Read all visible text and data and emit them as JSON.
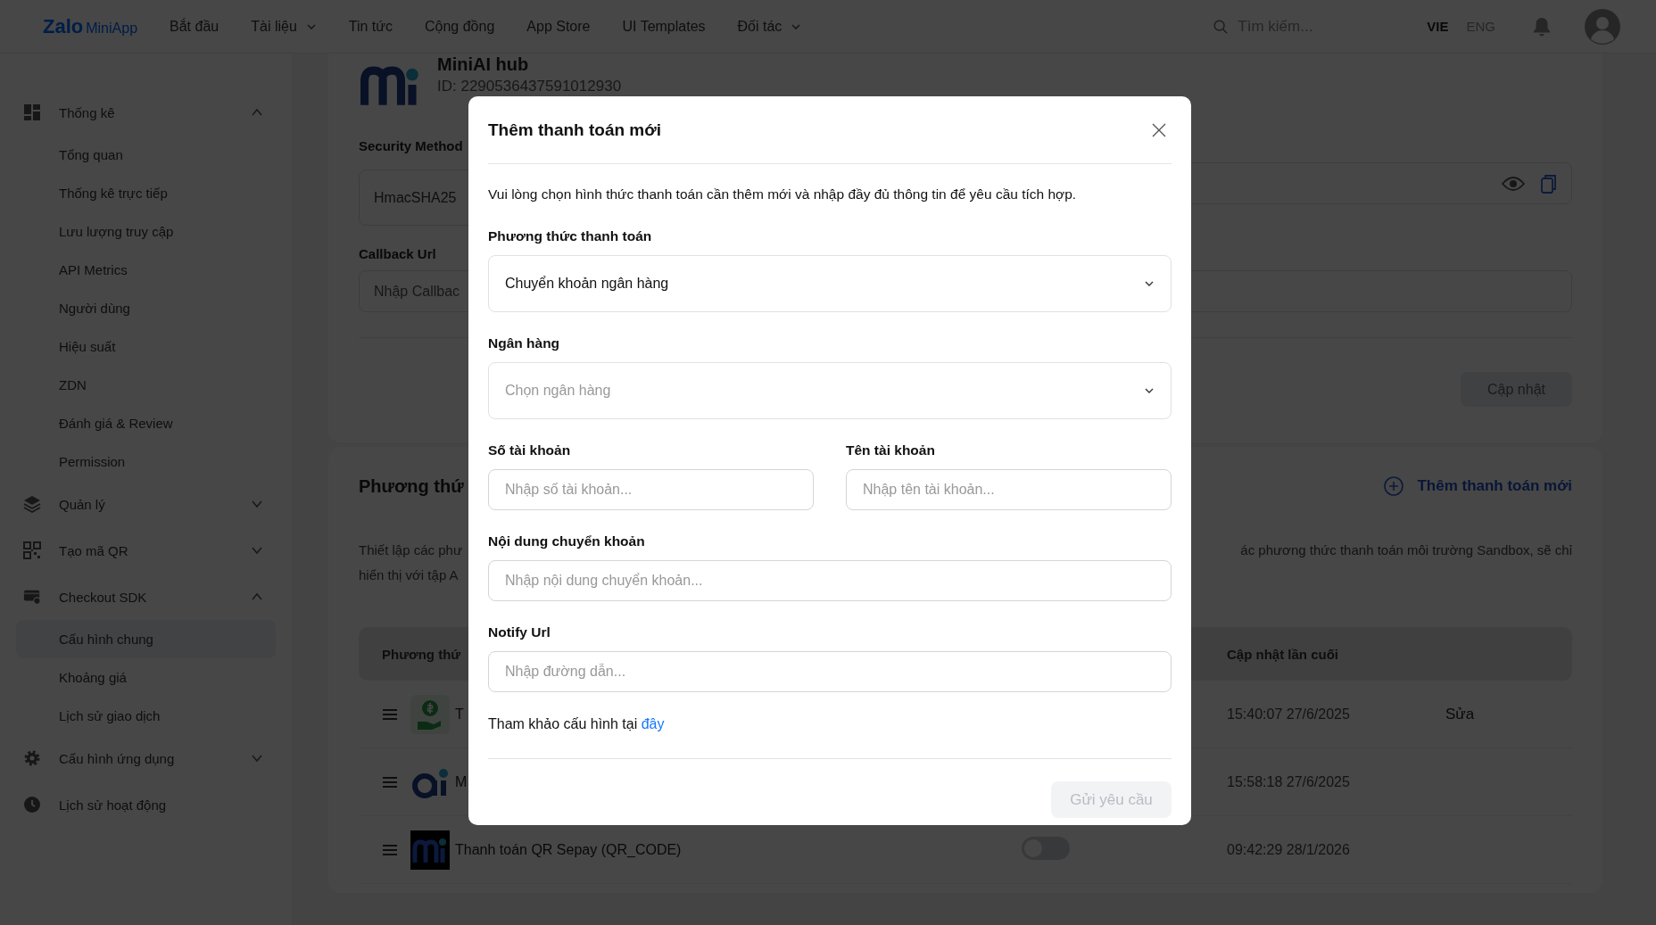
{
  "header": {
    "brand": "Zalo",
    "brand_sub": "MiniApp",
    "nav": [
      {
        "label": "Bắt đầu",
        "dropdown": false
      },
      {
        "label": "Tài liệu",
        "dropdown": true
      },
      {
        "label": "Tin tức",
        "dropdown": false
      },
      {
        "label": "Cộng đồng",
        "dropdown": false
      },
      {
        "label": "App Store",
        "dropdown": false
      },
      {
        "label": "UI Templates",
        "dropdown": false
      },
      {
        "label": "Đối tác",
        "dropdown": true
      }
    ],
    "search": {
      "placeholder": "Tìm kiếm..."
    },
    "languages": [
      {
        "label": "VIE",
        "selected": true
      },
      {
        "label": "ENG",
        "selected": false
      }
    ]
  },
  "sidebar": {
    "items": [
      {
        "label": "Thống kê",
        "expanded": true,
        "children": [
          {
            "label": "Tổng quan",
            "selected": false
          },
          {
            "label": "Thống kê trực tiếp",
            "selected": false
          },
          {
            "label": "Lưu lượng truy cập",
            "selected": false
          },
          {
            "label": "API Metrics",
            "selected": false
          },
          {
            "label": "Người dùng",
            "selected": false
          },
          {
            "label": "Hiệu suất",
            "selected": false
          },
          {
            "label": "ZDN",
            "selected": false
          },
          {
            "label": "Đánh giá & Review",
            "selected": false
          },
          {
            "label": "Permission",
            "selected": false
          }
        ]
      },
      {
        "label": "Quản lý",
        "expanded": false
      },
      {
        "label": "Tạo mã QR",
        "expanded": false
      },
      {
        "label": "Checkout SDK",
        "expanded": true,
        "children": [
          {
            "label": "Cấu hình chung",
            "selected": true
          },
          {
            "label": "Khoảng giá",
            "selected": false
          },
          {
            "label": "Lịch sử giao dịch",
            "selected": false
          }
        ]
      },
      {
        "label": "Cấu hình ứng dụng",
        "expanded": false
      },
      {
        "label": "Lịch sử hoạt động"
      }
    ]
  },
  "app": {
    "name": "MiniAI hub",
    "id": "ID: 2290536437591012930",
    "security": {
      "label": "Security Method",
      "value": "HmacSHA25"
    },
    "callback": {
      "label": "Callback Url",
      "placeholder": "Nhập Callbac"
    },
    "update_button": {
      "label": "Cập nhật",
      "disabled": true
    }
  },
  "payments": {
    "title": "Phương thứ",
    "add_link": "Thêm thanh toán mới",
    "description_left": [
      "Thiết lập các phư",
      "hiển thị với tập A"
    ],
    "description_right": "ác phương thức thanh toán môi trường Sandbox, sẽ chỉ",
    "columns": [
      "Phương thứ",
      "Cập nhật lần cuối"
    ],
    "rows": [
      {
        "name": "T",
        "updated": "15:40:07 27/6/2025",
        "action": "Sửa"
      },
      {
        "name": "M",
        "updated": "15:58:18 27/6/2025"
      },
      {
        "name": "Thanh toán QR Sepay (QR_CODE)",
        "on": false,
        "updated": "09:42:29 28/1/2026"
      }
    ]
  },
  "modal": {
    "title": "Thêm thanh toán mới",
    "description": "Vui lòng chọn hình thức thanh toán cần thêm mới và nhập đầy đủ thông tin để yêu cầu tích hợp.",
    "rows": [
      [
        {
          "kind": "select",
          "label": "Phương thức thanh toán",
          "value": "Chuyển khoản ngân hàng"
        }
      ],
      [
        {
          "kind": "select",
          "label": "Ngân hàng",
          "placeholder": "Chọn ngân hàng"
        }
      ],
      [
        {
          "kind": "input",
          "label": "Số tài khoản",
          "placeholder": "Nhập số tài khoản..."
        },
        {
          "kind": "input",
          "label": "Tên tài khoản",
          "placeholder": "Nhập tên tài khoản..."
        }
      ],
      [
        {
          "kind": "input",
          "label": "Nội dung chuyển khoản",
          "placeholder": "Nhập nội dung chuyển khoản..."
        }
      ],
      [
        {
          "kind": "input",
          "label": "Notify Url",
          "placeholder": "Nhập đường dẫn..."
        }
      ]
    ],
    "reference": {
      "text": "Tham khảo cấu hình tại",
      "link": "đây"
    },
    "submit": {
      "label": "Gửi yêu cầu",
      "disabled": true
    }
  }
}
